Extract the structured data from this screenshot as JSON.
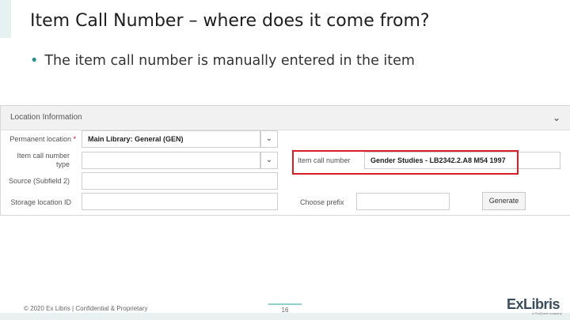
{
  "slide": {
    "title": "Item Call Number – where does it come from?",
    "bullet": "The item call number is manually entered in the item"
  },
  "panel": {
    "header": "Location Information",
    "fields": {
      "permanent_location": {
        "label": "Permanent location",
        "required_mark": "*",
        "value": "Main Library: General (GEN)"
      },
      "item_call_number_type": {
        "label_line1": "Item call number",
        "label_line2": "type",
        "value": ""
      },
      "source": {
        "label": "Source (Subfield 2)",
        "value": ""
      },
      "storage_location_id": {
        "label": "Storage location ID",
        "value": ""
      },
      "item_call_number": {
        "label": "Item call number",
        "value": "Gender Studies - LB2342.2.A8 M54 1997"
      },
      "choose_prefix": {
        "label": "Choose prefix",
        "value": ""
      }
    },
    "generate_button": "Generate"
  },
  "footer": {
    "copyright": "© 2020 Ex Libris | Confidential & Proprietary",
    "page_number": "16",
    "logo_text": "ExLibris",
    "logo_sub": "a ProQuest company"
  },
  "icons": {
    "dropdown": "chevron-down-icon",
    "collapse": "chevron-down-icon"
  },
  "colors": {
    "highlight": "#d91f26",
    "accent": "#2a8a96"
  }
}
